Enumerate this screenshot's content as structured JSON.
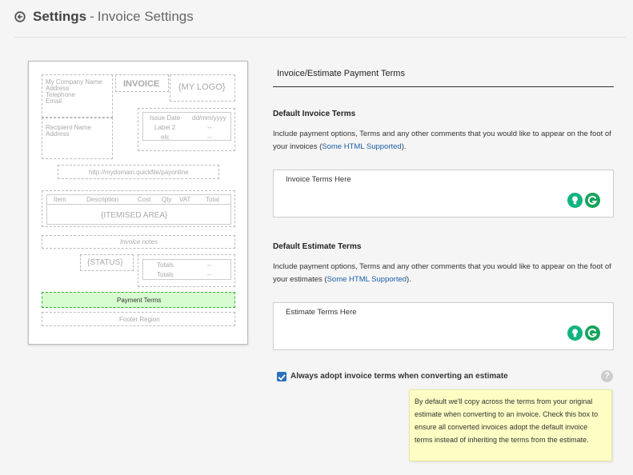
{
  "header": {
    "title": "Settings",
    "separator": "-",
    "subtitle": "Invoice Settings"
  },
  "preview": {
    "company_lines": [
      "My Company Name",
      "Address",
      "Telephone",
      "Email"
    ],
    "invoice_word": "INVOICE",
    "logo": "{MY LOGO}",
    "recipient_lines": [
      "Recipient Name",
      "Address"
    ],
    "dates": [
      [
        "Issue Date",
        "dd/mm/yyyy"
      ],
      [
        "Label 2",
        "--"
      ],
      [
        "etc",
        "--"
      ]
    ],
    "url": "http://mydomain.quickfile/payonline",
    "item_headers": [
      "Item",
      "Description",
      "Cost",
      "Qty",
      "VAT",
      "Total"
    ],
    "itemised": "{ITEMISED AREA}",
    "notes": "Invoice notes",
    "status": "{STATUS}",
    "totals": [
      [
        "Totals",
        "--"
      ],
      [
        "Totals",
        "--"
      ]
    ],
    "payment_terms": "Payment Terms",
    "footer": "Footer Region"
  },
  "terms": {
    "section_title": "Invoice/Estimate Payment Terms",
    "invoice": {
      "title": "Default Invoice Terms",
      "help_text": "Include payment options, Terms and any other comments that you would like to appear on the foot of your invoices (",
      "link": "Some HTML Supported",
      "help_end": ").",
      "placeholder": "Invoice Terms Here"
    },
    "estimate": {
      "title": "Default Estimate Terms",
      "help_text": "Include payment options, Terms and any other comments that you would like to appear on the foot of your estimates (",
      "link": "Some HTML Supported",
      "help_end": ").",
      "placeholder": "Estimate Terms Here"
    },
    "checkbox_label": "Always adopt invoice terms when converting an estimate",
    "checkbox_checked": true,
    "help_icon": "?",
    "tooltip": "By default we'll copy across the terms from your original estimate when converting to an invoice. Check this box to ensure all converted invoices adopt the default invoice terms instead of inheriting the terms from the estimate."
  },
  "colors": {
    "accent": "#2c6fbf",
    "link": "#1a5fa8",
    "payment_terms_bg": "#d7fcd0",
    "tooltip_bg": "#fefec4"
  }
}
